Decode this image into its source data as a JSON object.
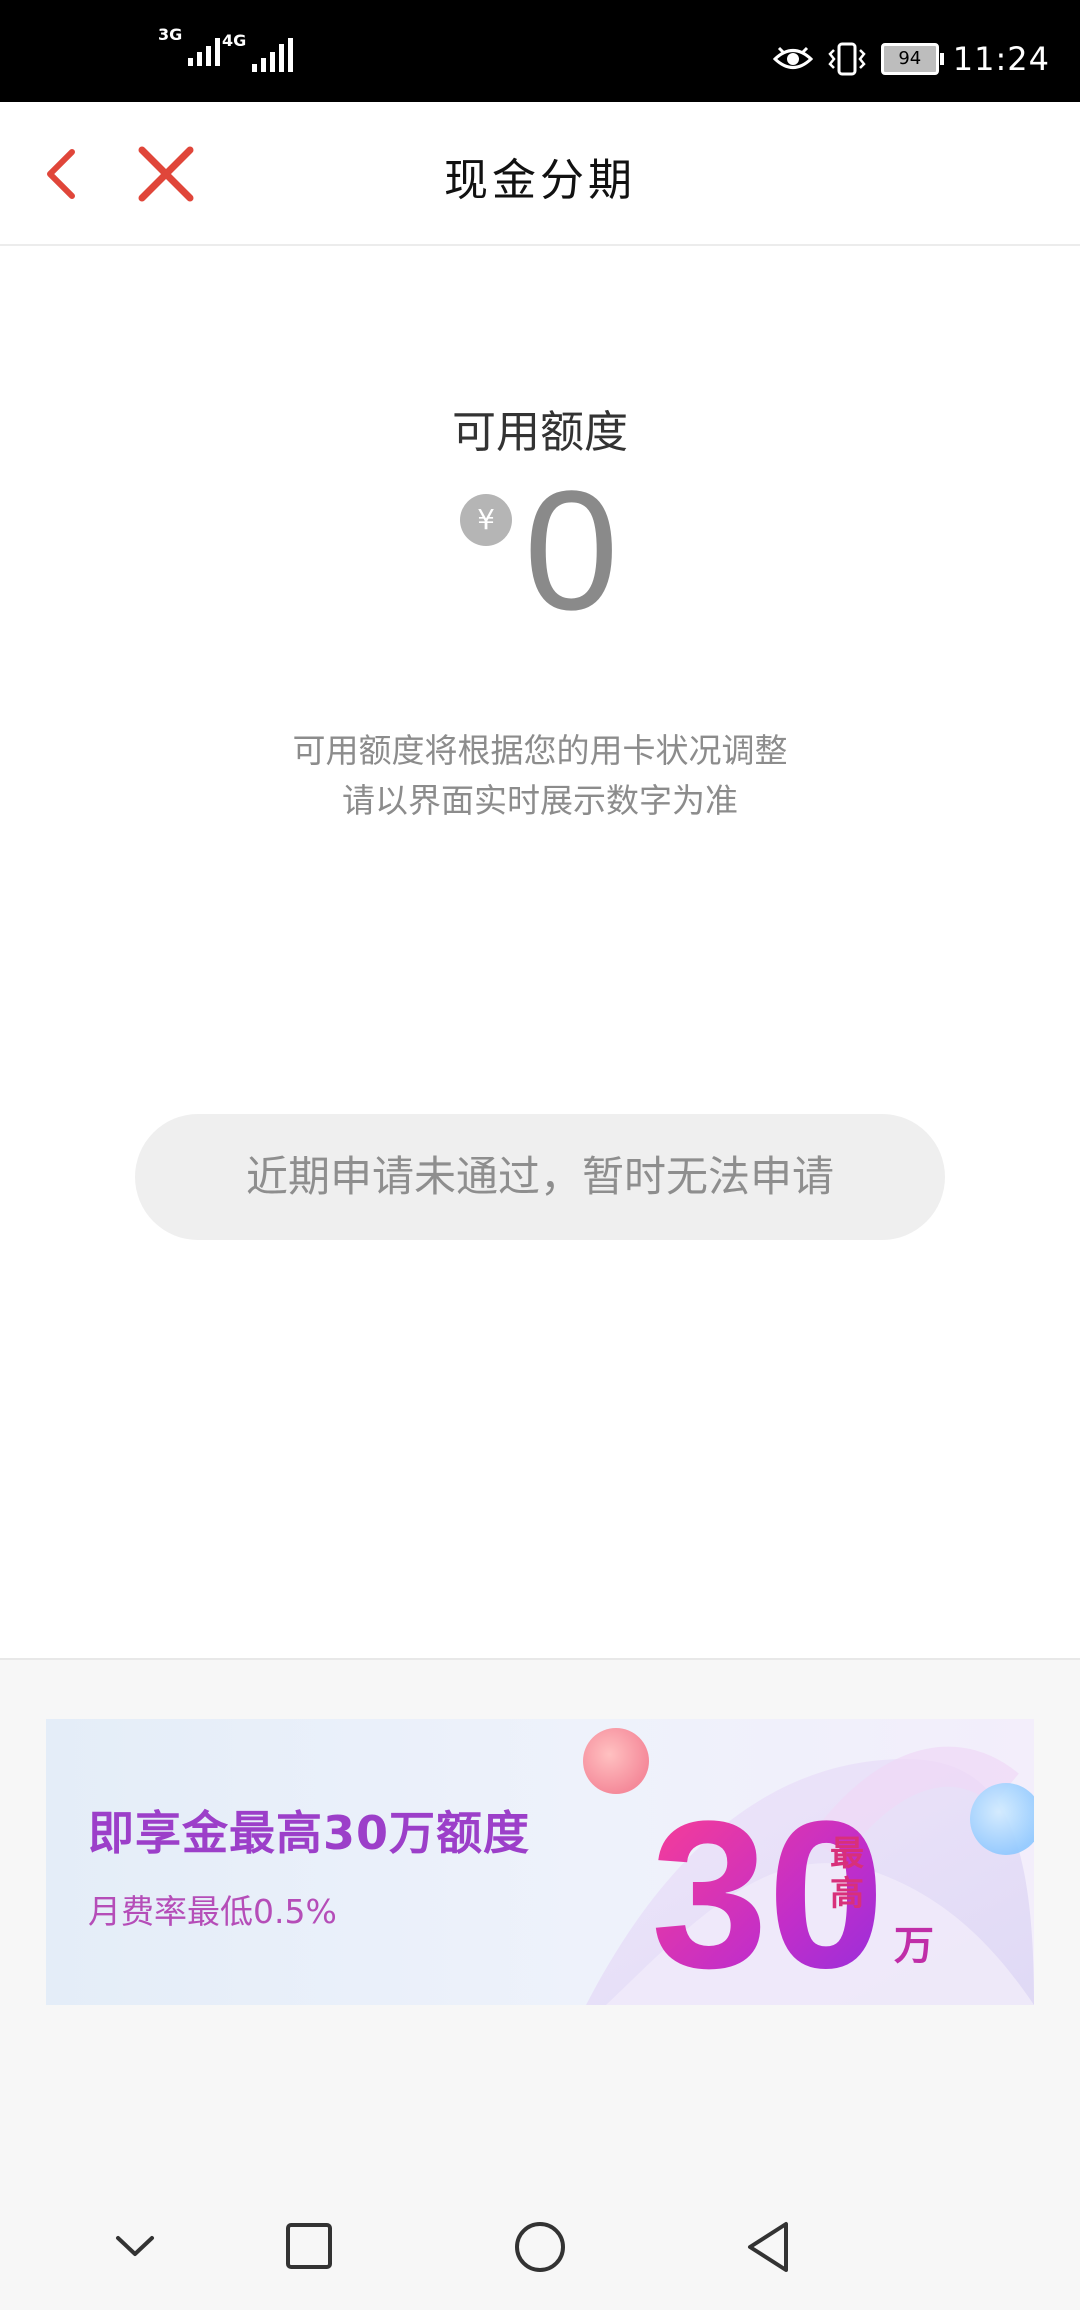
{
  "status_bar": {
    "net1": "3G",
    "net2": "4G",
    "battery": "94",
    "time": "11:24",
    "icons": [
      "eye-comfort-icon",
      "vibrate-icon"
    ]
  },
  "navbar": {
    "title": "现金分期",
    "back_icon": "chevron-left-icon",
    "close_icon": "close-icon",
    "accent": "#e0463a"
  },
  "quota": {
    "label": "可用额度",
    "currency": "¥",
    "amount": "0",
    "note_line1": "可用额度将根据您的用卡状况调整",
    "note_line2": "请以界面实时展示数字为准"
  },
  "apply_button": {
    "label": "近期申请未通过，暂时无法申请",
    "disabled": true
  },
  "banner": {
    "headline": "即享金最高30万额度",
    "subline": "月费率最低0.5%",
    "big_number": "30",
    "tag_top": "最",
    "tag_bottom": "高",
    "unit": "万"
  },
  "system_nav": [
    "dropdown-icon",
    "recent-apps-icon",
    "home-icon",
    "back-icon"
  ]
}
